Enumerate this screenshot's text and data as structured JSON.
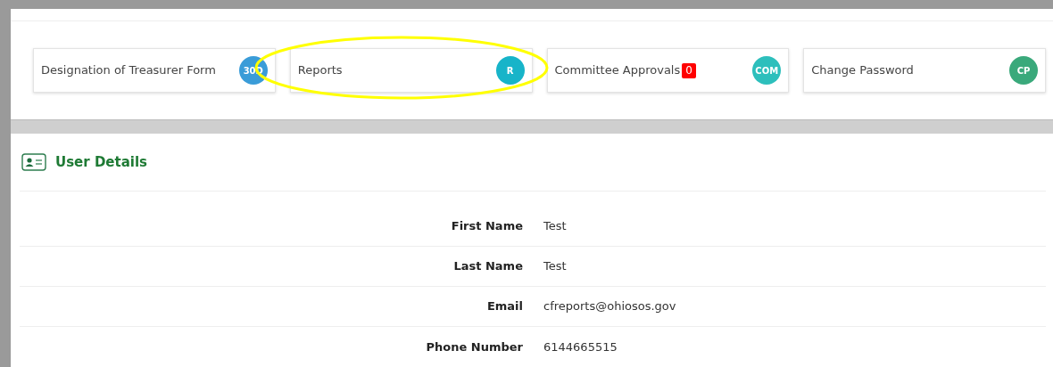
{
  "tiles": [
    {
      "label": "Designation of Treasurer Form",
      "initials": "30D",
      "color": "#3a9cd8"
    },
    {
      "label": "Reports",
      "initials": "R",
      "color": "#17b4c9"
    },
    {
      "label": "Committee Approvals",
      "badge": "0",
      "initials": "COM",
      "color": "#2dbfbc"
    },
    {
      "label": "Change Password",
      "initials": "CP",
      "color": "#3aa97b"
    }
  ],
  "user_details": {
    "title": "User Details",
    "fields": [
      {
        "label": "First Name",
        "value": "Test"
      },
      {
        "label": "Last Name",
        "value": "Test"
      },
      {
        "label": "Email",
        "value": "cfreports@ohiosos.gov"
      },
      {
        "label": "Phone Number",
        "value": "6144665515"
      }
    ]
  }
}
